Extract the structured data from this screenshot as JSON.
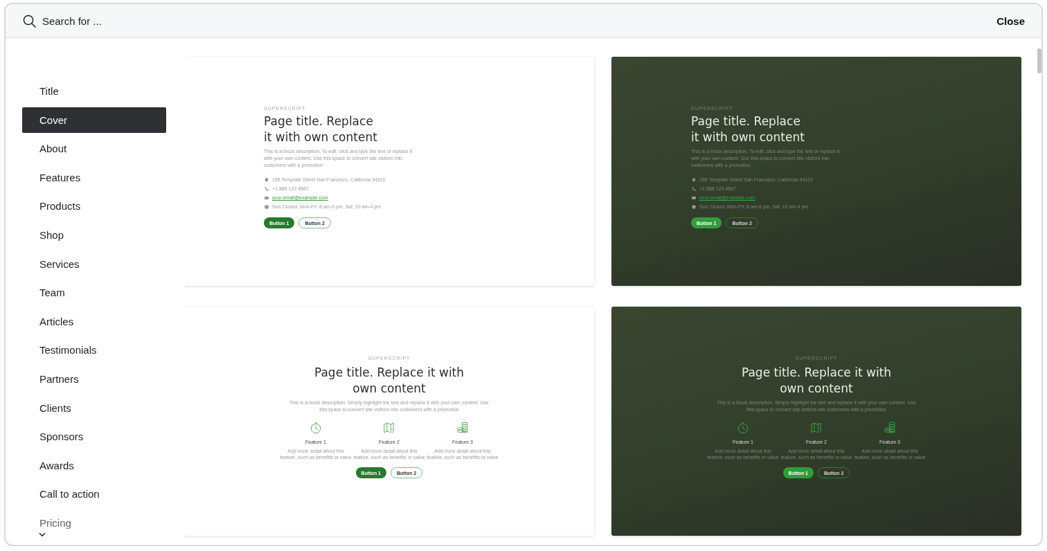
{
  "search": {
    "placeholder": "Search for ..."
  },
  "close_button": {
    "label": "Close"
  },
  "sidebar": {
    "items": [
      {
        "label": "Title",
        "selected": false
      },
      {
        "label": "Cover",
        "selected": true
      },
      {
        "label": "About",
        "selected": false
      },
      {
        "label": "Features",
        "selected": false
      },
      {
        "label": "Products",
        "selected": false
      },
      {
        "label": "Shop",
        "selected": false
      },
      {
        "label": "Services",
        "selected": false
      },
      {
        "label": "Team",
        "selected": false
      },
      {
        "label": "Articles",
        "selected": false
      },
      {
        "label": "Testimonials",
        "selected": false
      },
      {
        "label": "Partners",
        "selected": false
      },
      {
        "label": "Clients",
        "selected": false
      },
      {
        "label": "Sponsors",
        "selected": false
      },
      {
        "label": "Awards",
        "selected": false
      },
      {
        "label": "Call to action",
        "selected": false
      },
      {
        "label": "Pricing",
        "selected": false
      }
    ]
  },
  "templates": [
    {
      "kind": "contact",
      "photo": false,
      "superscript": "SUPERSCRIPT",
      "title": "Page title. Replace it with own content",
      "description": "This is a block description. To edit, click and type the text or replace it with your own content. Use this space to convert site visitors into customers with a promotion",
      "contacts": [
        {
          "kind": "address",
          "text": "155 Template Street San Francisco, California 94110"
        },
        {
          "kind": "phone",
          "text": "+1 888 123 4567"
        },
        {
          "kind": "email",
          "text": "your.email@example.com"
        },
        {
          "kind": "hours",
          "text": "Sun Closed, Mon-Fri: 8 am-6 pm, Sat: 10 am-4 pm"
        }
      ],
      "buttons": [
        {
          "kind": "filled",
          "label": "Button 1"
        },
        {
          "kind": "outline",
          "label": "Button 2"
        }
      ]
    },
    {
      "kind": "contact",
      "photo": true,
      "superscript": "SUPERSCRIPT",
      "title": "Page title. Replace it with own content",
      "description": "This is a block description. To edit, click and type the text or replace it with your own content. Use this space to convert site visitors into customers with a promotion",
      "contacts": [
        {
          "kind": "address",
          "text": "155 Template Street San Francisco, California 94110"
        },
        {
          "kind": "phone",
          "text": "+1 888 123 4567"
        },
        {
          "kind": "email",
          "text": "your.email@example.com"
        },
        {
          "kind": "hours",
          "text": "Sun Closed, Mon-Fri: 8 am-6 pm, Sat: 10 am-4 pm"
        }
      ],
      "buttons": [
        {
          "kind": "filled",
          "label": "Button 1"
        },
        {
          "kind": "outline",
          "label": "Button 2"
        }
      ]
    },
    {
      "kind": "features",
      "photo": false,
      "superscript": "SUPERSCRIPT",
      "title": "Page title. Replace it with own content",
      "description": "This is a block description. Simply highlight the text and replace it with your own content. Use this space to convert site visitors into customers with a promotion",
      "features": [
        {
          "kind": "clock",
          "title": "Feature 1",
          "text": "Add more detail about this feature, such as benefits or value"
        },
        {
          "kind": "map",
          "title": "Feature 2",
          "text": "Add more detail about this feature, such as benefits or value"
        },
        {
          "kind": "coins",
          "title": "Feature 3",
          "text": "Add more detail about this feature, such as benefits or value"
        }
      ],
      "buttons": [
        {
          "kind": "filled",
          "label": "Button 1"
        },
        {
          "kind": "outline",
          "label": "Button 2"
        }
      ]
    },
    {
      "kind": "features",
      "photo": true,
      "superscript": "SUPERSCRIPT",
      "title": "Page title. Replace it with own content",
      "description": "This is a block description. Simply highlight the text and replace it with your own content. Use this space to convert site visitors into customers with a promotion",
      "features": [
        {
          "kind": "clock",
          "title": "Feature 1",
          "text": "Add more detail about this feature, such as benefits or value"
        },
        {
          "kind": "map",
          "title": "Feature 2",
          "text": "Add more detail about this feature, such as benefits or value"
        },
        {
          "kind": "coins",
          "title": "Feature 3",
          "text": "Add more detail about this feature, such as benefits or value"
        }
      ],
      "buttons": [
        {
          "kind": "filled",
          "label": "Button 1"
        },
        {
          "kind": "outline",
          "label": "Button 2"
        }
      ]
    }
  ]
}
